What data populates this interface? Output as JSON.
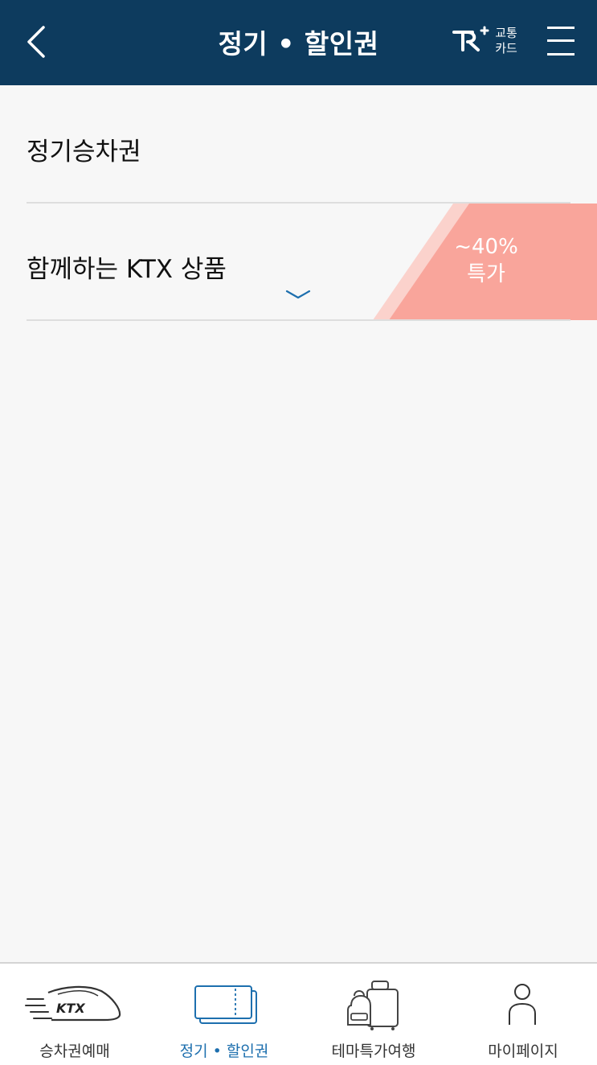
{
  "header": {
    "title": "정기 • 할인권",
    "back_icon": "chevron-left-icon",
    "card_logo": "rail-plus-logo",
    "card_line1": "교통",
    "card_line2": "카드",
    "menu_icon": "hamburger-menu-icon"
  },
  "list": {
    "items": [
      {
        "label": "정기승차권"
      },
      {
        "label": "함께하는 KTX 상품",
        "expand_icon": "chevron-down-icon"
      }
    ]
  },
  "badge": {
    "line1": "~40%",
    "line2": "특가",
    "color": "#f9a59b",
    "stripe_color": "#fbd2cc"
  },
  "tabbar": {
    "active_index": 1,
    "active_color": "#1d6fae",
    "tabs": [
      {
        "label": "승차권예매",
        "icon": "ktx-train-icon"
      },
      {
        "label": "정기 • 할인권",
        "icon": "ticket-icon"
      },
      {
        "label": "테마특가여행",
        "icon": "luggage-icon"
      },
      {
        "label": "마이페이지",
        "icon": "person-icon"
      }
    ]
  },
  "colors": {
    "header_bg": "#0d3b5e",
    "page_bg": "#f7f7f7"
  }
}
